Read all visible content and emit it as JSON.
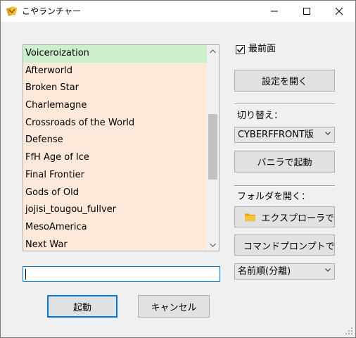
{
  "window": {
    "title": "こやランチャー",
    "controls": {
      "minimize": "minimize",
      "maximize": "maximize",
      "close": "close"
    }
  },
  "mod_list": {
    "items": [
      "Voiceroization",
      "Afterworld",
      "Broken Star",
      "Charlemagne",
      "Crossroads of the World",
      "Defense",
      "FfH Age of Ice",
      "Final Frontier",
      "Gods of Old",
      "jojisi_tougou_fullver",
      "MesoAmerica",
      "Next War"
    ],
    "selected_index": 0,
    "scroll_thumb_position": 0.49,
    "scroll_thumb_size": 0.36
  },
  "search_input": {
    "value": "",
    "placeholder": ""
  },
  "buttons": {
    "launch": "起動",
    "cancel": "キャンセル",
    "open_settings": "設定を開く",
    "vanilla_launch": "バニラで起動",
    "explorer": "エクスプローラで",
    "command_prompt": "コマンドプロンプトで"
  },
  "always_on_top": {
    "label": "最前面",
    "checked": true
  },
  "switch_section": {
    "label": "切り替え：",
    "selected": "CYBERFFRONT版"
  },
  "folder_section": {
    "label": "フォルダを開く："
  },
  "sort_select": {
    "selected": "名前順(分離)"
  },
  "colors": {
    "list_background": "#fde9d9",
    "selected_item": "#ccf0cc",
    "focus_blue": "#0078d7",
    "folder_icon": "#f5c342"
  },
  "icons": {
    "app": "app-icon",
    "folder": "folder-icon",
    "terminal": "terminal-icon",
    "chevron": "chevron-down-icon"
  }
}
